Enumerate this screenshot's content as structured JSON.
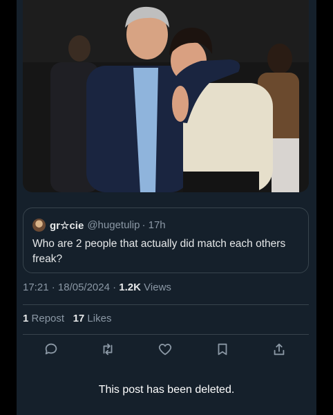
{
  "quote": {
    "author_name": "gr☆cie",
    "author_handle": "@hugetulip",
    "time_ago": "· 17h",
    "text": "Who are 2 people that actually did match each others freak?"
  },
  "meta": {
    "time": "17:21",
    "date": "· 18/05/2024 ·",
    "views_count": "1.2K",
    "views_label": "Views"
  },
  "stats": {
    "reposts_count": "1",
    "reposts_label": "Repost",
    "likes_count": "17",
    "likes_label": "Likes"
  },
  "actions": [
    "reply-icon",
    "repost-icon",
    "like-icon",
    "bookmark-icon",
    "share-icon"
  ],
  "notice": "This post has been deleted.",
  "colors": {
    "background": "#15202b",
    "border": "#38444d",
    "secondary_text": "#8b98a5",
    "primary_text": "#e7e9ea"
  }
}
